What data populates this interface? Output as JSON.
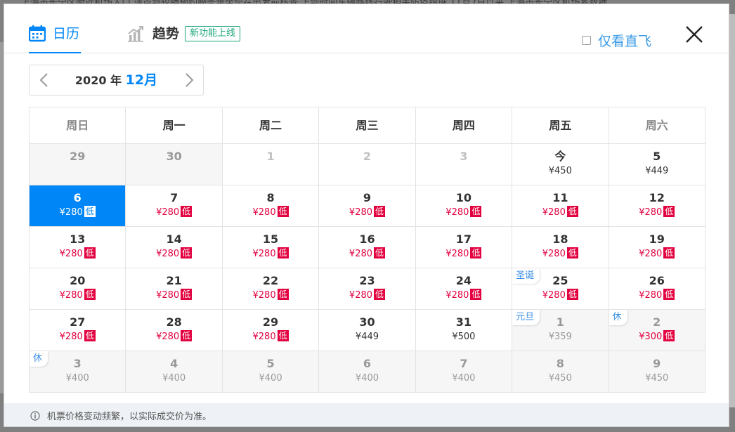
{
  "backdrop": {
    "text": "上海市长宁区附近机场入口   请点刮轮播预约服务乘坐您在出发前核查    上到时间车辆路线行驶相关防疫措施          11月7日以来  上海市长宁区机场乡数据"
  },
  "tabs": [
    {
      "label": "日历",
      "icon": "calendar-icon",
      "active": true
    },
    {
      "label": "趋势",
      "icon": "trend-chart-icon",
      "active": false,
      "badge": "新功能上线"
    }
  ],
  "filter": {
    "direct_only_label": "仅看直飞",
    "checked": false
  },
  "month_nav": {
    "year": "2020",
    "year_suffix": "年",
    "month": "12月"
  },
  "weekdays": [
    "周日",
    "周一",
    "周二",
    "周三",
    "周四",
    "周五",
    "周六"
  ],
  "low_tag": "低",
  "weeks": [
    [
      {
        "day": "29",
        "price": "",
        "state": "past"
      },
      {
        "day": "30",
        "price": "",
        "state": "past"
      },
      {
        "day": "1",
        "price": "",
        "state": "faded"
      },
      {
        "day": "2",
        "price": "",
        "state": "faded"
      },
      {
        "day": "3",
        "price": "",
        "state": "faded"
      },
      {
        "day": "今",
        "price": "¥450",
        "state": "normal"
      },
      {
        "day": "5",
        "price": "¥449",
        "state": "normal"
      }
    ],
    [
      {
        "day": "6",
        "price": "¥280",
        "low": true,
        "state": "selected"
      },
      {
        "day": "7",
        "price": "¥280",
        "low": true,
        "state": "normal"
      },
      {
        "day": "8",
        "price": "¥280",
        "low": true,
        "state": "normal"
      },
      {
        "day": "9",
        "price": "¥280",
        "low": true,
        "state": "normal"
      },
      {
        "day": "10",
        "price": "¥280",
        "low": true,
        "state": "normal"
      },
      {
        "day": "11",
        "price": "¥280",
        "low": true,
        "state": "normal"
      },
      {
        "day": "12",
        "price": "¥280",
        "low": true,
        "state": "normal"
      }
    ],
    [
      {
        "day": "13",
        "price": "¥280",
        "low": true,
        "state": "normal"
      },
      {
        "day": "14",
        "price": "¥280",
        "low": true,
        "state": "normal"
      },
      {
        "day": "15",
        "price": "¥280",
        "low": true,
        "state": "normal"
      },
      {
        "day": "16",
        "price": "¥280",
        "low": true,
        "state": "normal"
      },
      {
        "day": "17",
        "price": "¥280",
        "low": true,
        "state": "normal"
      },
      {
        "day": "18",
        "price": "¥280",
        "low": true,
        "state": "normal"
      },
      {
        "day": "19",
        "price": "¥280",
        "low": true,
        "state": "normal"
      }
    ],
    [
      {
        "day": "20",
        "price": "¥280",
        "low": true,
        "state": "normal"
      },
      {
        "day": "21",
        "price": "¥280",
        "low": true,
        "state": "normal"
      },
      {
        "day": "22",
        "price": "¥280",
        "low": true,
        "state": "normal"
      },
      {
        "day": "23",
        "price": "¥280",
        "low": true,
        "state": "normal"
      },
      {
        "day": "24",
        "price": "¥280",
        "low": true,
        "state": "normal"
      },
      {
        "day": "25",
        "price": "¥280",
        "low": true,
        "state": "normal",
        "tag": "圣诞"
      },
      {
        "day": "26",
        "price": "¥280",
        "low": true,
        "state": "normal"
      }
    ],
    [
      {
        "day": "27",
        "price": "¥280",
        "low": true,
        "state": "normal"
      },
      {
        "day": "28",
        "price": "¥280",
        "low": true,
        "state": "normal"
      },
      {
        "day": "29",
        "price": "¥280",
        "low": true,
        "state": "normal"
      },
      {
        "day": "30",
        "price": "¥449",
        "state": "normal"
      },
      {
        "day": "31",
        "price": "¥500",
        "state": "normal"
      },
      {
        "day": "1",
        "price": "¥359",
        "state": "next",
        "tag": "元旦"
      },
      {
        "day": "2",
        "price": "¥300",
        "low": true,
        "state": "next",
        "tag": "休"
      }
    ],
    [
      {
        "day": "3",
        "price": "¥400",
        "state": "next",
        "tag": "休"
      },
      {
        "day": "4",
        "price": "¥400",
        "state": "next"
      },
      {
        "day": "5",
        "price": "¥400",
        "state": "next"
      },
      {
        "day": "6",
        "price": "¥400",
        "state": "next"
      },
      {
        "day": "7",
        "price": "¥400",
        "state": "next"
      },
      {
        "day": "8",
        "price": "¥450",
        "state": "next"
      },
      {
        "day": "9",
        "price": "¥450",
        "state": "next"
      }
    ]
  ],
  "footer": {
    "notice": "机票价格变动频繁，以实际成交价为准。",
    "icon": "info-icon"
  },
  "colors": {
    "accent": "#0086f6",
    "low_price": "#e2003f",
    "badge_green": "#1aa57a"
  }
}
